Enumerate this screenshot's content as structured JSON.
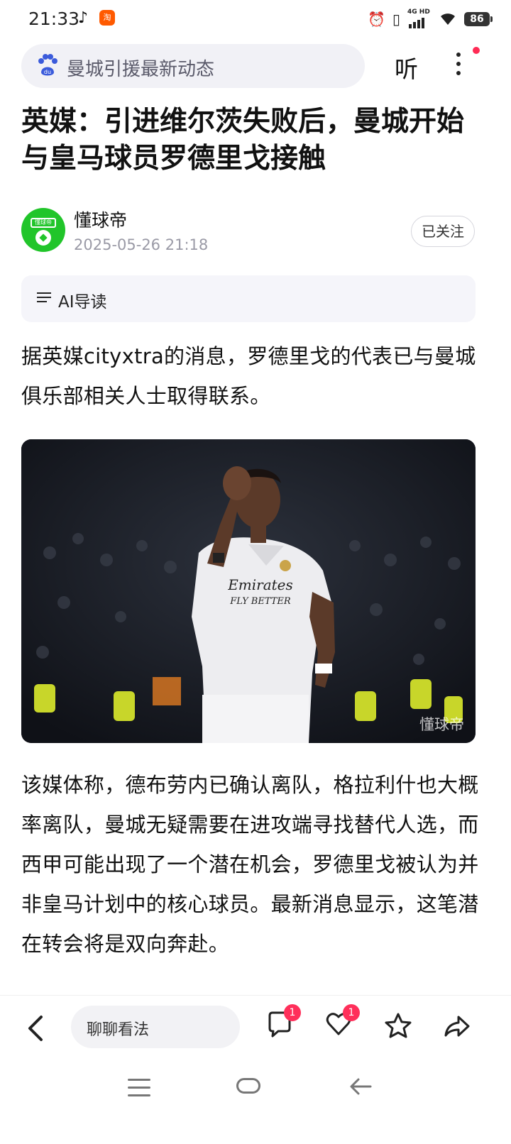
{
  "status_bar": {
    "time": "21:33",
    "network_label": "4G HD",
    "battery": "86"
  },
  "header": {
    "search_text": "曼城引援最新动态",
    "listen_label": "听"
  },
  "article": {
    "title": "英媒：引进维尔茨失败后，曼城开始与皇马球员罗德里戈接触",
    "author": {
      "name": "懂球帝",
      "date": "2025-05-26 21:18",
      "follow_label": "已关注",
      "avatar_text": "懂球帝"
    },
    "ai_label": "AI导读",
    "paragraph1": "据英媒cityxtra的消息，罗德里戈的代表已与曼城俱乐部相关人士取得联系。",
    "image_watermark": "懂球帝",
    "paragraph2": "该媒体称，德布劳内已确认离队，格拉利什也大概率离队，曼城无疑需要在进攻端寻找替代人选，而西甲可能出现了一个潜在机会，罗德里戈被认为并非皇马计划中的核心球员。最新消息显示，这笔潜在转会将是双向奔赴。"
  },
  "bottom_bar": {
    "comment_placeholder": "聊聊看法",
    "comment_count": "1",
    "like_count": "1"
  },
  "colors": {
    "accent_red": "#ff2f5a",
    "avatar_green": "#21c52a",
    "baidu_blue": "#3b5bdb"
  }
}
